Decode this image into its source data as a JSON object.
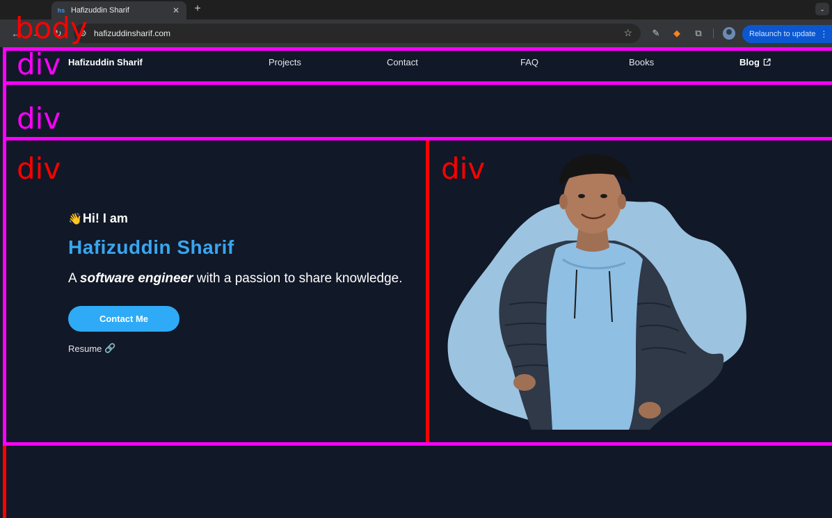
{
  "browser": {
    "tab_title": "Hafizuddin Sharif",
    "tab_favicon": "hs",
    "new_tab_glyph": "+",
    "close_glyph": "✕",
    "url": "hafizuddinsharif.com",
    "relaunch_label": "Relaunch to update",
    "icons": [
      "back-icon",
      "forward-icon",
      "reload-icon",
      "site-info-icon",
      "star-icon",
      "eyedropper-icon",
      "metamask-fox-icon",
      "extensions-puzzle-icon",
      "profile-avatar-icon",
      "more-vert-icon"
    ]
  },
  "navbar": {
    "brand": "Hafizuddin Sharif",
    "links": [
      "Projects",
      "Contact",
      "FAQ",
      "Books"
    ],
    "blog_label": "Blog"
  },
  "hero": {
    "wave_emoji": "👋",
    "greeting": "Hi! I am",
    "name": "Hafizuddin Sharif",
    "tagline_prefix": "A ",
    "tagline_emphasis": "software engineer",
    "tagline_suffix": " with a passion to share knowledge.",
    "contact_button": "Contact Me",
    "resume_label": "Resume",
    "resume_icon": "🔗"
  },
  "annotations": {
    "body_label": "body",
    "div_label": "div"
  },
  "colors": {
    "page_bg": "#111827",
    "accent": "#38a6f0",
    "button": "#2eaaf7",
    "blob": "#9cc3e0",
    "annotation_magenta": "#ff00ff",
    "annotation_red": "#ff0000"
  }
}
